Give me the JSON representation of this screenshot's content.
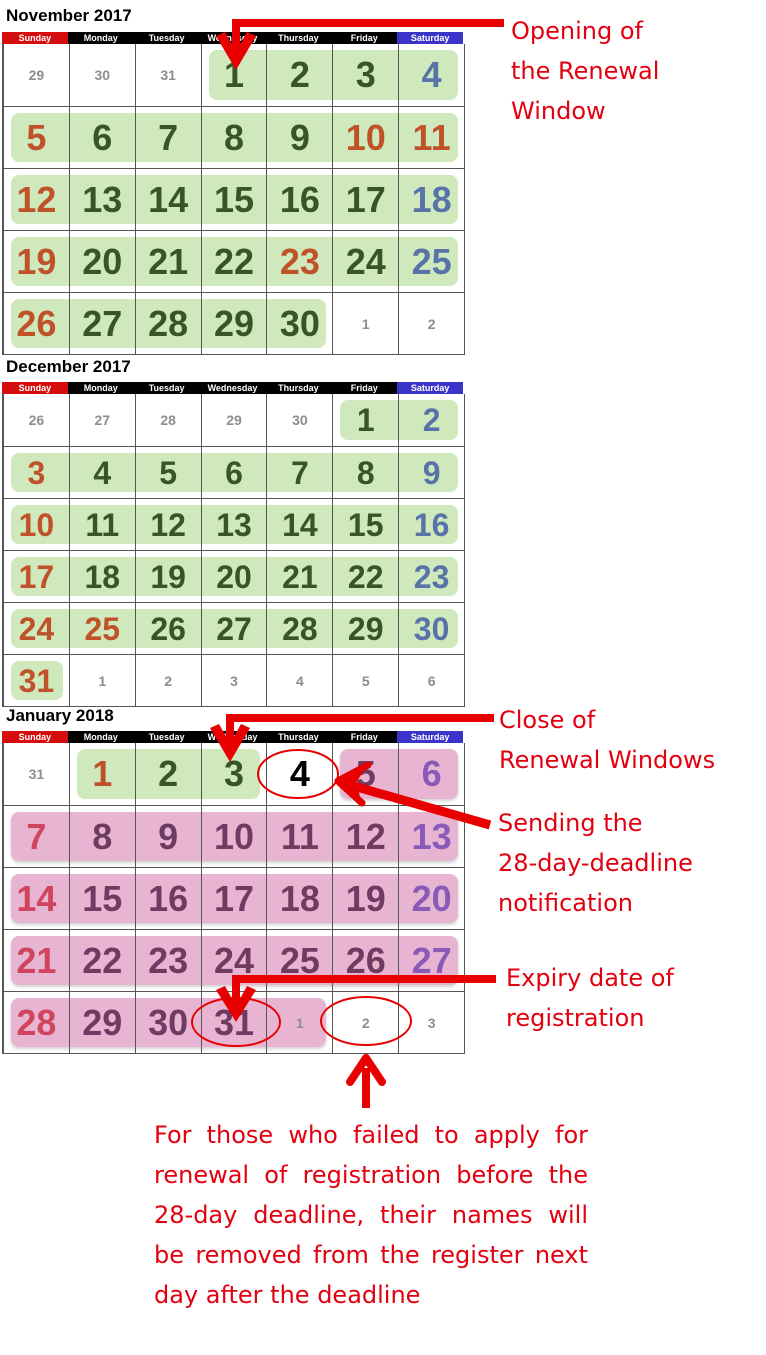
{
  "weekdays": [
    "Sunday",
    "Monday",
    "Tuesday",
    "Wednesday",
    "Thursday",
    "Friday",
    "Saturday"
  ],
  "colors": {
    "sunday_header": "#d50d0d",
    "saturday_header": "#3a35c8",
    "renewal_window_band": "#cfe9bd",
    "post_deadline_band": "#e7b5d1",
    "annotation_red": "#e3000f"
  },
  "calendars": [
    {
      "title": "November 2017",
      "weeks": [
        [
          {
            "d": "29",
            "o": true
          },
          {
            "d": "30",
            "o": true
          },
          {
            "d": "31",
            "o": true
          },
          {
            "d": "1",
            "c": "green"
          },
          {
            "d": "2",
            "c": "green"
          },
          {
            "d": "3",
            "c": "green"
          },
          {
            "d": "4",
            "c": "blue"
          }
        ],
        [
          {
            "d": "5",
            "c": "orange"
          },
          {
            "d": "6",
            "c": "green"
          },
          {
            "d": "7",
            "c": "green"
          },
          {
            "d": "8",
            "c": "green"
          },
          {
            "d": "9",
            "c": "green"
          },
          {
            "d": "10",
            "c": "orange"
          },
          {
            "d": "11",
            "c": "orange"
          }
        ],
        [
          {
            "d": "12",
            "c": "orange"
          },
          {
            "d": "13",
            "c": "green"
          },
          {
            "d": "14",
            "c": "green"
          },
          {
            "d": "15",
            "c": "green"
          },
          {
            "d": "16",
            "c": "green"
          },
          {
            "d": "17",
            "c": "green"
          },
          {
            "d": "18",
            "c": "blue"
          }
        ],
        [
          {
            "d": "19",
            "c": "orange"
          },
          {
            "d": "20",
            "c": "green"
          },
          {
            "d": "21",
            "c": "green"
          },
          {
            "d": "22",
            "c": "green"
          },
          {
            "d": "23",
            "c": "orange"
          },
          {
            "d": "24",
            "c": "green"
          },
          {
            "d": "25",
            "c": "blue"
          }
        ],
        [
          {
            "d": "26",
            "c": "orange"
          },
          {
            "d": "27",
            "c": "green"
          },
          {
            "d": "28",
            "c": "green"
          },
          {
            "d": "29",
            "c": "green"
          },
          {
            "d": "30",
            "c": "green"
          },
          {
            "d": "1",
            "o": true
          },
          {
            "d": "2",
            "o": true
          }
        ]
      ],
      "bands": [
        {
          "week": 0,
          "from": 3,
          "to": 6,
          "type": "green"
        },
        {
          "week": 1,
          "from": 0,
          "to": 6,
          "type": "green"
        },
        {
          "week": 2,
          "from": 0,
          "to": 6,
          "type": "green"
        },
        {
          "week": 3,
          "from": 0,
          "to": 6,
          "type": "green"
        },
        {
          "week": 4,
          "from": 0,
          "to": 4,
          "type": "green"
        }
      ]
    },
    {
      "title": "December 2017",
      "weeks": [
        [
          {
            "d": "26",
            "o": true
          },
          {
            "d": "27",
            "o": true
          },
          {
            "d": "28",
            "o": true
          },
          {
            "d": "29",
            "o": true
          },
          {
            "d": "30",
            "o": true
          },
          {
            "d": "1",
            "c": "green"
          },
          {
            "d": "2",
            "c": "blue"
          }
        ],
        [
          {
            "d": "3",
            "c": "orange"
          },
          {
            "d": "4",
            "c": "green"
          },
          {
            "d": "5",
            "c": "green"
          },
          {
            "d": "6",
            "c": "green"
          },
          {
            "d": "7",
            "c": "green"
          },
          {
            "d": "8",
            "c": "green"
          },
          {
            "d": "9",
            "c": "blue"
          }
        ],
        [
          {
            "d": "10",
            "c": "orange"
          },
          {
            "d": "11",
            "c": "green"
          },
          {
            "d": "12",
            "c": "green"
          },
          {
            "d": "13",
            "c": "green"
          },
          {
            "d": "14",
            "c": "green"
          },
          {
            "d": "15",
            "c": "green"
          },
          {
            "d": "16",
            "c": "blue"
          }
        ],
        [
          {
            "d": "17",
            "c": "orange"
          },
          {
            "d": "18",
            "c": "green"
          },
          {
            "d": "19",
            "c": "green"
          },
          {
            "d": "20",
            "c": "green"
          },
          {
            "d": "21",
            "c": "green"
          },
          {
            "d": "22",
            "c": "green"
          },
          {
            "d": "23",
            "c": "blue"
          }
        ],
        [
          {
            "d": "24",
            "c": "orange"
          },
          {
            "d": "25",
            "c": "orange"
          },
          {
            "d": "26",
            "c": "green"
          },
          {
            "d": "27",
            "c": "green"
          },
          {
            "d": "28",
            "c": "green"
          },
          {
            "d": "29",
            "c": "green"
          },
          {
            "d": "30",
            "c": "blue"
          }
        ],
        [
          {
            "d": "31",
            "c": "orange"
          },
          {
            "d": "1",
            "o": true
          },
          {
            "d": "2",
            "o": true
          },
          {
            "d": "3",
            "o": true
          },
          {
            "d": "4",
            "o": true
          },
          {
            "d": "5",
            "o": true
          },
          {
            "d": "6",
            "o": true
          }
        ]
      ],
      "bands": [
        {
          "week": 0,
          "from": 5,
          "to": 6,
          "type": "green"
        },
        {
          "week": 1,
          "from": 0,
          "to": 6,
          "type": "green"
        },
        {
          "week": 2,
          "from": 0,
          "to": 6,
          "type": "green"
        },
        {
          "week": 3,
          "from": 0,
          "to": 6,
          "type": "green"
        },
        {
          "week": 4,
          "from": 0,
          "to": 6,
          "type": "green"
        },
        {
          "week": 5,
          "from": 0,
          "to": 0,
          "type": "green"
        }
      ]
    },
    {
      "title": "January 2018",
      "weeks": [
        [
          {
            "d": "31",
            "o": true
          },
          {
            "d": "1",
            "c": "orange"
          },
          {
            "d": "2",
            "c": "green"
          },
          {
            "d": "3",
            "c": "green"
          },
          {
            "d": "4",
            "c": "black"
          },
          {
            "d": "5",
            "c": "plum"
          },
          {
            "d": "6",
            "c": "violet"
          }
        ],
        [
          {
            "d": "7",
            "c": "pink-red"
          },
          {
            "d": "8",
            "c": "plum"
          },
          {
            "d": "9",
            "c": "plum"
          },
          {
            "d": "10",
            "c": "plum"
          },
          {
            "d": "11",
            "c": "plum"
          },
          {
            "d": "12",
            "c": "plum"
          },
          {
            "d": "13",
            "c": "violet"
          }
        ],
        [
          {
            "d": "14",
            "c": "pink-red"
          },
          {
            "d": "15",
            "c": "plum"
          },
          {
            "d": "16",
            "c": "plum"
          },
          {
            "d": "17",
            "c": "plum"
          },
          {
            "d": "18",
            "c": "plum"
          },
          {
            "d": "19",
            "c": "plum"
          },
          {
            "d": "20",
            "c": "violet"
          }
        ],
        [
          {
            "d": "21",
            "c": "pink-red"
          },
          {
            "d": "22",
            "c": "plum"
          },
          {
            "d": "23",
            "c": "plum"
          },
          {
            "d": "24",
            "c": "plum"
          },
          {
            "d": "25",
            "c": "plum"
          },
          {
            "d": "26",
            "c": "plum"
          },
          {
            "d": "27",
            "c": "violet"
          }
        ],
        [
          {
            "d": "28",
            "c": "pink-red"
          },
          {
            "d": "29",
            "c": "plum"
          },
          {
            "d": "30",
            "c": "plum"
          },
          {
            "d": "31",
            "c": "plum"
          },
          {
            "d": "1",
            "o": true
          },
          {
            "d": "2",
            "o": true
          },
          {
            "d": "3",
            "o": true
          }
        ]
      ],
      "bands": [
        {
          "week": 0,
          "from": 1,
          "to": 3,
          "type": "green"
        },
        {
          "week": 0,
          "from": 5,
          "to": 6,
          "type": "pink"
        },
        {
          "week": 1,
          "from": 0,
          "to": 6,
          "type": "pink"
        },
        {
          "week": 2,
          "from": 0,
          "to": 6,
          "type": "pink"
        },
        {
          "week": 3,
          "from": 0,
          "to": 6,
          "type": "pink"
        },
        {
          "week": 4,
          "from": 0,
          "to": 4,
          "type": "pink"
        }
      ]
    }
  ],
  "annotations": {
    "opening": [
      "Opening of",
      "the Renewal",
      "Window"
    ],
    "close": [
      "Close of",
      "Renewal Windows"
    ],
    "sending": [
      "Sending the",
      "28-day-deadline",
      "notification"
    ],
    "expiry": [
      "Expiry date of",
      "registration"
    ],
    "removal": "For those who failed to apply for renewal of registration before the 28-day deadline, their names will be removed from the register next day after the deadline"
  }
}
